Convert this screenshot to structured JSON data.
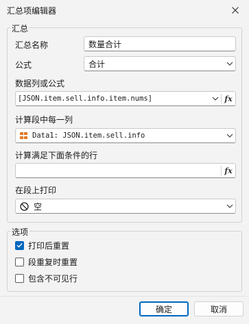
{
  "window": {
    "title": "汇总项编辑器"
  },
  "summary_group": {
    "title": "汇总",
    "name_label": "汇总名称",
    "name_value": "数量合计",
    "formula_label": "公式",
    "formula_value": "合计",
    "column_label": "数据列或公式",
    "column_value": "[JSON.item.sell.info.item.nums]",
    "fx_label": "fx",
    "each_label": "计算段中每一列",
    "each_value": "Data1: JSON.item.sell.info",
    "condition_label": "计算满足下面条件的行",
    "condition_value": "",
    "print_label": "在段上打印",
    "print_value": "空"
  },
  "options_group": {
    "title": "选项",
    "items": [
      {
        "label": "打印后重置",
        "checked": true
      },
      {
        "label": "段重复时重置",
        "checked": false
      },
      {
        "label": "包含不可见行",
        "checked": false
      }
    ]
  },
  "buttons": {
    "ok": "确定",
    "cancel": "取消"
  },
  "colors": {
    "accent": "#0067c0",
    "db_icon": "#e07a2a"
  }
}
